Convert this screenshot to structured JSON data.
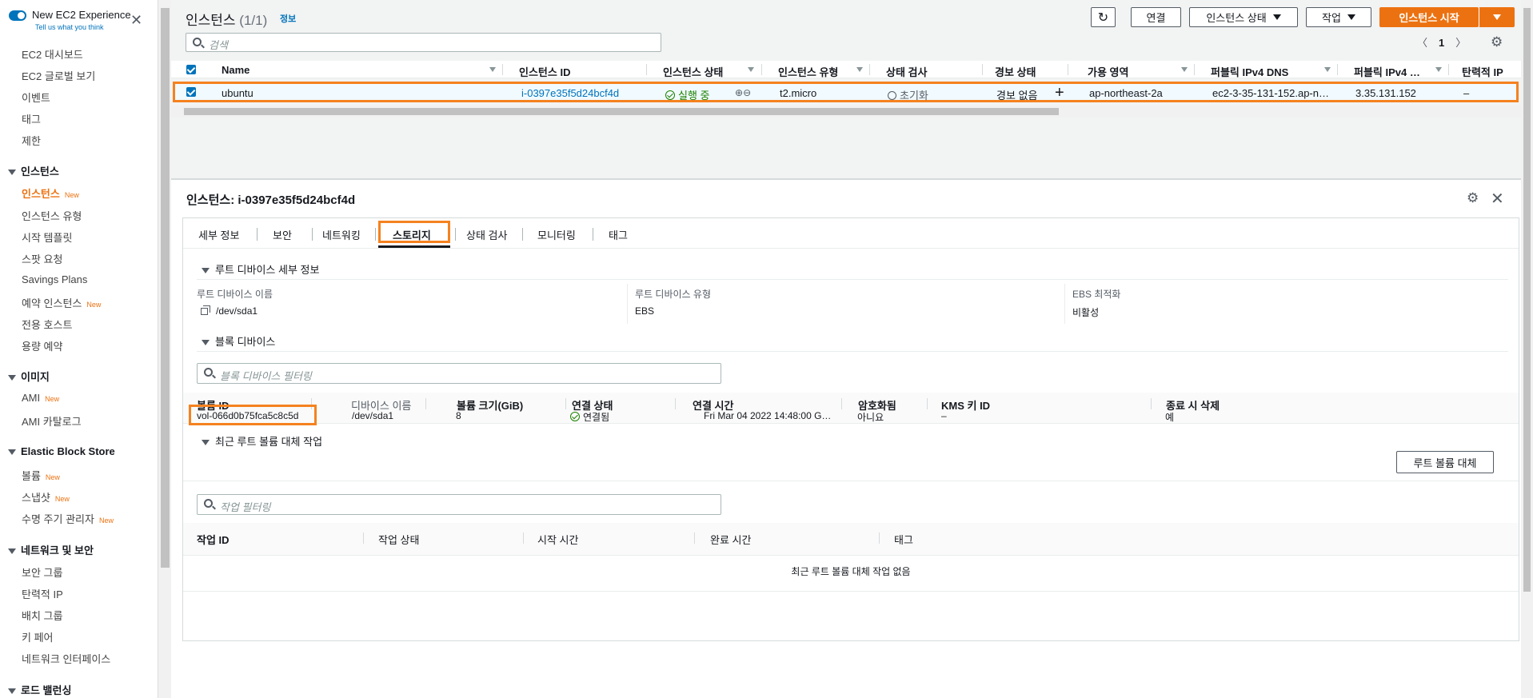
{
  "sidebar": {
    "experience_label": "New EC2 Experience",
    "feedback_link": "Tell us what you think",
    "items": [
      {
        "label": "EC2 대시보드",
        "new": ""
      },
      {
        "label": "EC2 글로벌 보기",
        "new": ""
      },
      {
        "label": "이벤트",
        "new": ""
      },
      {
        "label": "태그",
        "new": ""
      },
      {
        "label": "제한",
        "new": ""
      }
    ],
    "sections": [
      {
        "title": "인스턴스",
        "items": [
          {
            "label": "인스턴스",
            "new": "New"
          },
          {
            "label": "인스턴스 유형",
            "new": ""
          },
          {
            "label": "시작 템플릿",
            "new": ""
          },
          {
            "label": "스팟 요청",
            "new": ""
          },
          {
            "label": "Savings Plans",
            "new": ""
          },
          {
            "label": "예약 인스턴스",
            "new": "New"
          },
          {
            "label": "전용 호스트",
            "new": ""
          },
          {
            "label": "용량 예약",
            "new": ""
          }
        ]
      },
      {
        "title": "이미지",
        "items": [
          {
            "label": "AMI",
            "new": "New"
          },
          {
            "label": "AMI 카탈로그",
            "new": ""
          }
        ]
      },
      {
        "title": "Elastic Block Store",
        "items": [
          {
            "label": "볼륨",
            "new": "New"
          },
          {
            "label": "스냅샷",
            "new": "New"
          },
          {
            "label": "수명 주기 관리자",
            "new": "New"
          }
        ]
      },
      {
        "title": "네트워크 및 보안",
        "items": [
          {
            "label": "보안 그룹",
            "new": ""
          },
          {
            "label": "탄력적 IP",
            "new": ""
          },
          {
            "label": "배치 그룹",
            "new": ""
          },
          {
            "label": "키 페어",
            "new": ""
          },
          {
            "label": "네트워크 인터페이스",
            "new": ""
          }
        ]
      },
      {
        "title": "로드 밸런싱",
        "items": []
      }
    ]
  },
  "list": {
    "title": "인스턴스",
    "count": "(1/1)",
    "info": "정보",
    "buttons": {
      "refresh_icon": "refresh-icon",
      "connect": "연결",
      "instance_state": "인스턴스 상태",
      "actions": "작업",
      "launch": "인스턴스 시작"
    },
    "search_placeholder": "검색",
    "page": "1",
    "columns": [
      "Name",
      "인스턴스 ID",
      "인스턴스 상태",
      "인스턴스 유형",
      "상태 검사",
      "경보 상태",
      "가용 영역",
      "퍼블릭 IPv4 DNS",
      "퍼블릭 IPv4 …",
      "탄력적 IP"
    ],
    "row": {
      "name": "ubuntu",
      "instance_id": "i-0397e35f5d24bcf4d",
      "state": "실행 중",
      "type": "t2.micro",
      "status_check": "초기화",
      "alarm": "경보 없음",
      "az": "ap-northeast-2a",
      "dns": "ec2-3-35-131-152.ap-n…",
      "ipv4": "3.35.131.152",
      "elastic_ip": "–"
    }
  },
  "detail": {
    "title": "인스턴스: i-0397e35f5d24bcf4d",
    "tabs": [
      "세부 정보",
      "보안",
      "네트워킹",
      "스토리지",
      "상태 검사",
      "모니터링",
      "태그"
    ],
    "active_tab": "스토리지",
    "root_section": "루트 디바이스 세부 정보",
    "root": {
      "name_label": "루트 디바이스 이름",
      "name_value": "/dev/sda1",
      "type_label": "루트 디바이스 유형",
      "type_value": "EBS",
      "ebs_label": "EBS 최적화",
      "ebs_value": "비활성"
    },
    "block_section": "블록 디바이스",
    "block_filter_placeholder": "블록 디바이스 필터링",
    "block_columns": [
      "볼륨 ID",
      "디바이스 이름",
      "볼륨 크기(GiB)",
      "연결 상태",
      "연결 시간",
      "암호화됨",
      "KMS 키 ID",
      "종료 시 삭제"
    ],
    "block_row": {
      "volume_id": "vol-066d0b75fca5c8c5d",
      "device": "/dev/sda1",
      "size": "8",
      "attach_state": "연결됨",
      "attach_time": "Fri Mar 04 2022 14:48:00 G…",
      "encrypted": "아니요",
      "kms": "–",
      "delete_on_term": "예"
    },
    "replace_section": "최근 루트 볼륨 대체 작업",
    "replace_button": "루트 볼륨 대체",
    "task_filter_placeholder": "작업 필터링",
    "task_columns": [
      "작업 ID",
      "작업 상태",
      "시작 시간",
      "완료 시간",
      "태그"
    ],
    "task_empty": "최근 루트 볼륨 대체 작업 없음"
  },
  "colors": {
    "accent": "#ec7211",
    "link": "#0073bb",
    "success": "#1d8102",
    "highlight": "#f5821f"
  }
}
